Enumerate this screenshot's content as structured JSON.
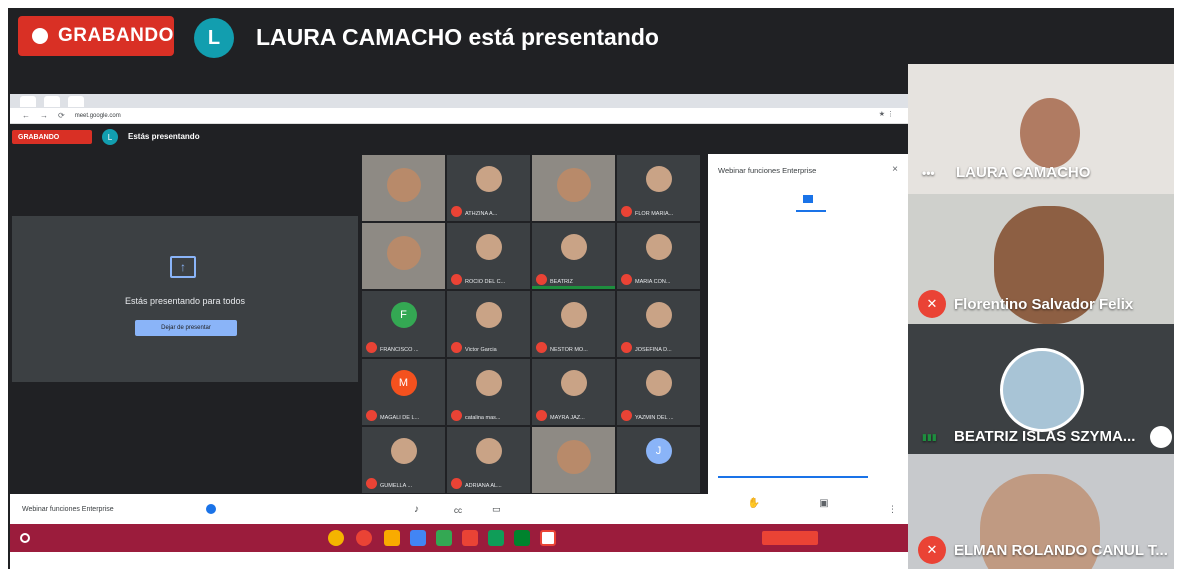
{
  "header": {
    "recording_label": "GRABANDO",
    "presenter_initial": "L",
    "presenter_title": "LAURA CAMACHO está presentando"
  },
  "shared_screen": {
    "tabs": [
      "",
      "",
      ""
    ],
    "url": "meet.google.com",
    "inner_recording_label": "GRABANDO",
    "inner_presenter_initial": "L",
    "inner_presenting": "Estás presentando",
    "present_message": "Estás presentando para todos",
    "stop_button": "Dejar de presentar",
    "grid": [
      {
        "name": "",
        "type": "video"
      },
      {
        "name": "ATHZINA A...",
        "type": "avatar"
      },
      {
        "name": "",
        "type": "video"
      },
      {
        "name": "FLOR MARIA...",
        "type": "avatar"
      },
      {
        "name": "",
        "type": "video"
      },
      {
        "name": "ROCIO DEL C...",
        "type": "avatar"
      },
      {
        "name": "BEATRIZ",
        "type": "avatar",
        "speaking": true
      },
      {
        "name": "MARIA CON...",
        "type": "avatar"
      },
      {
        "name": "FRANCISCO ...",
        "type": "initial",
        "initial": "F",
        "color": "#34a853"
      },
      {
        "name": "Victor Garcia",
        "type": "avatar"
      },
      {
        "name": "NESTOR MO...",
        "type": "avatar"
      },
      {
        "name": "JOSEFINA D...",
        "type": "avatar"
      },
      {
        "name": "MAGALI DE L...",
        "type": "initial",
        "initial": "M",
        "color": "#f4511e"
      },
      {
        "name": "catalina mas...",
        "type": "avatar"
      },
      {
        "name": "MAYRA JAZ...",
        "type": "avatar"
      },
      {
        "name": "YAZMIN DEL ...",
        "type": "avatar"
      },
      {
        "name": "GUMELLA ...",
        "type": "avatar"
      },
      {
        "name": "ADRIANA AL...",
        "type": "avatar"
      },
      {
        "name": "",
        "type": "video"
      },
      {
        "name": "",
        "type": "initial",
        "initial": "J",
        "color": "#8ab4f8"
      }
    ],
    "panel": {
      "title": "Webinar funciones Enterprise",
      "close": "×",
      "tab_people": "",
      "tab_activities": "",
      "input_placeholder": ""
    },
    "bottom_bar": {
      "meeting_name": "Webinar funciones Enterprise",
      "raise_hand": "",
      "present_now": ""
    },
    "shelf": {
      "sign_out": "",
      "tray": ""
    }
  },
  "tiles": [
    {
      "name": "LAURA CAMACHO",
      "status": "more",
      "bg": "#e6e3df"
    },
    {
      "name": "Florentino Salvador Felix",
      "status": "muted",
      "bg": "#cfd0cc"
    },
    {
      "name": "BEATRIZ ISLAS SZYMA...",
      "status": "speaking",
      "bg": "#3c4043"
    },
    {
      "name": "ELMAN ROLANDO CANUL T...",
      "status": "muted",
      "bg": "#c7c9cc"
    }
  ],
  "colors": {
    "recording_red": "#d93025",
    "presenter_teal": "#129eaf",
    "meet_dark": "#202124",
    "shelf": "#9b1c3c"
  }
}
